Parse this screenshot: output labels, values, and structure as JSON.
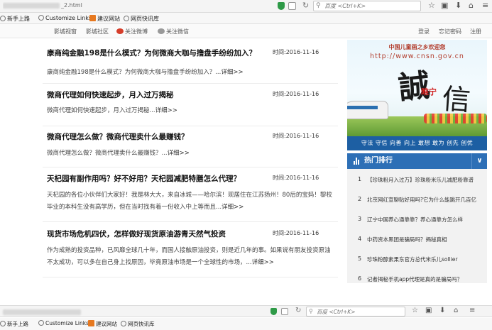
{
  "browser": {
    "url_suffix": "_2.html",
    "search_placeholder": "百度 <Ctrl+K>",
    "reload_glyph": "↻",
    "icons": [
      "star-icon",
      "clipboard-icon",
      "download-icon",
      "home-icon",
      "menu-icon"
    ]
  },
  "bookmarks": [
    {
      "label": "新手上路",
      "icon": "globe-icon"
    },
    {
      "label": "Customize Links",
      "icon": "globe-icon"
    },
    {
      "label": "建议网站",
      "icon": "orange-square-icon"
    },
    {
      "label": "网页快讯库",
      "icon": "globe-icon"
    }
  ],
  "site_header": {
    "left": [
      "影城视窗",
      "影城社区",
      "关注微博",
      "关注微信"
    ],
    "right": [
      "登录",
      "忘记密码",
      "注册"
    ]
  },
  "articles": [
    {
      "title": "康商纯金融198是什么模式？为何微商大咖与撸盘手纷纷加入？",
      "time": "时间:2016-11-16",
      "summary": "康商纯金融198是什么模式？为何微商大咖与撸盘手纷纷加入？...",
      "more": "详细>>"
    },
    {
      "title": "微商代理如何快速起步，月入过万揭秘",
      "time": "时间:2016-11-16",
      "summary": "微商代理如何快速起步，月入过万揭秘...",
      "more": "详细>>"
    },
    {
      "title": "微商代理怎么做？微商代理卖什么最赚钱？",
      "time": "时间:2016-11-16",
      "summary": "微商代理怎么做？微商代理卖什么最赚钱？...",
      "more": "详细>>"
    },
    {
      "title": "天杞园有副作用吗？好不好用？天杞园减肥特膳怎么代理？",
      "time": "时间:2016-11-16",
      "summary_line1": "天杞园的各位小伙伴们大家好！我是林大大，来自冰城——哈尔滨！现居住在江苏扬州！80后的宝妈！黎校",
      "summary_line2": "毕业的本科生没有高学历，但在当时找有着一份收入中上等而且...",
      "more": "详细>>"
    },
    {
      "title": "现货市场危机四伏，怎样做好现货原油游青天然气投资",
      "time": "时间:2016-11-16",
      "summary_line1": "作为成熟的投资品种，已风靡全球几十年，而国人接触原油投资，则是近几年的事。如果说有朋友投资原油",
      "summary_line2": "不太成功，可以多在自己身上找原因，毕竟原油市场是一个全球性的市场，...",
      "more": "详细>>"
    }
  ],
  "banner": {
    "heading": "中国儿童画之乡欢迎您",
    "url": "http://www.cnsn.gov.cn",
    "calligraphy_1": "誠",
    "calligraphy_2": "信",
    "red_text": "睢宁"
  },
  "slogan": "守法 守信 向善 向上 敢想 敢为 创先 创优",
  "hot": {
    "title": "热门排行",
    "toggle": "∨",
    "items": [
      {
        "num": "1",
        "text": "【珍珠粉月入过万】珍珠粉米乐儿减肥粉靠谱"
      },
      {
        "num": "2",
        "text": "北京网红宣聊贴好用吗?它为什么能跳开几百亿"
      },
      {
        "num": "3",
        "text": "辽宁中国养心通靠靠？养心通靠方怎么样"
      },
      {
        "num": "4",
        "text": "中药资本黑团是骗局吗？揭秘真相"
      },
      {
        "num": "5",
        "text": "珍珠粉醇素果东官方总代米乐儿sollier"
      },
      {
        "num": "6",
        "text": "记者揭秘手机app代理是真的是骗局吗？"
      }
    ]
  },
  "bottom_bar": {
    "search_placeholder": "百度 <Ctrl+K>",
    "reload_glyph": "↻"
  }
}
